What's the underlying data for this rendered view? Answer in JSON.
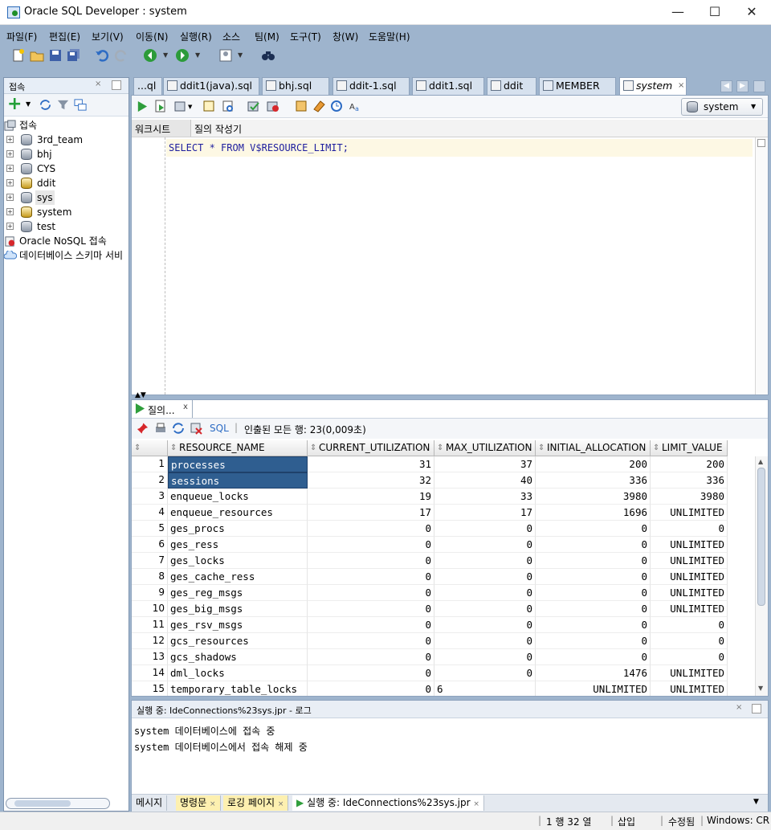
{
  "window": {
    "title": "Oracle SQL Developer : system",
    "minimize": "—",
    "maximize": "☐",
    "close": "✕"
  },
  "menu": [
    "파일(F)",
    "편집(E)",
    "보기(V)",
    "이동(N)",
    "실행(R)",
    "소스",
    "팀(M)",
    "도구(T)",
    "창(W)",
    "도움말(H)"
  ],
  "navigator": {
    "tab_label": "접속",
    "root_label": "접속",
    "connections": [
      "3rd_team",
      "bhj",
      "CYS",
      "ddit",
      "sys",
      "system",
      "test"
    ],
    "selected": "sys",
    "extra": [
      "Oracle NoSQL 접속",
      "데이터베이스 스키마 서비"
    ]
  },
  "doc_tabs": [
    {
      "label": "...ql"
    },
    {
      "label": "ddit1(java).sql"
    },
    {
      "label": "bhj.sql"
    },
    {
      "label": "ddit-1.sql"
    },
    {
      "label": "ddit1.sql"
    },
    {
      "label": "ddit"
    },
    {
      "label": "MEMBER"
    },
    {
      "label": "system",
      "active": true
    }
  ],
  "editor": {
    "connection_selector": "system",
    "subtabs": [
      "워크시트",
      "질의 작성기"
    ],
    "sql_text": "SELECT * FROM V$RESOURCE_LIMIT;"
  },
  "results": {
    "tab_label": "질의...",
    "sql_link": "SQL",
    "status": "인출된 모든 행: 23(0,009초)",
    "columns": [
      "RESOURCE_NAME",
      "CURRENT_UTILIZATION",
      "MAX_UTILIZATION",
      "INITIAL_ALLOCATION",
      "LIMIT_VALUE"
    ],
    "rows": [
      [
        "1",
        "processes",
        "31",
        "37",
        "200",
        "200"
      ],
      [
        "2",
        "sessions",
        "32",
        "40",
        "336",
        "336"
      ],
      [
        "3",
        "enqueue_locks",
        "19",
        "33",
        "3980",
        "3980"
      ],
      [
        "4",
        "enqueue_resources",
        "17",
        "17",
        "1696",
        "UNLIMITED"
      ],
      [
        "5",
        "ges_procs",
        "0",
        "0",
        "0",
        "0"
      ],
      [
        "6",
        "ges_ress",
        "0",
        "0",
        "0",
        "UNLIMITED"
      ],
      [
        "7",
        "ges_locks",
        "0",
        "0",
        "0",
        "UNLIMITED"
      ],
      [
        "8",
        "ges_cache_ress",
        "0",
        "0",
        "0",
        "UNLIMITED"
      ],
      [
        "9",
        "ges_reg_msgs",
        "0",
        "0",
        "0",
        "UNLIMITED"
      ],
      [
        "10",
        "ges_big_msgs",
        "0",
        "0",
        "0",
        "UNLIMITED"
      ],
      [
        "11",
        "ges_rsv_msgs",
        "0",
        "0",
        "0",
        "0"
      ],
      [
        "12",
        "gcs_resources",
        "0",
        "0",
        "0",
        "0"
      ],
      [
        "13",
        "gcs_shadows",
        "0",
        "0",
        "0",
        "0"
      ],
      [
        "14",
        "dml_locks",
        "0",
        "0",
        "1476",
        "UNLIMITED"
      ],
      [
        "15",
        "temporary_table_locks",
        "0",
        "6",
        "UNLIMITED",
        "UNLIMITED"
      ]
    ]
  },
  "log": {
    "title": "실행 중: IdeConnections%23sys.jpr - 로그",
    "lines": [
      "system 데이터베이스에 접속 중",
      "system 데이터베이스에서 접속 해제 중"
    ],
    "tabs": [
      "메시지",
      "명령문",
      "로깅 페이지",
      "실행 중: IdeConnections%23sys.jpr"
    ]
  },
  "status": {
    "position": "1 행 32 열",
    "mode": "삽입",
    "modified": "수정됨",
    "os": "Windows: CR"
  }
}
